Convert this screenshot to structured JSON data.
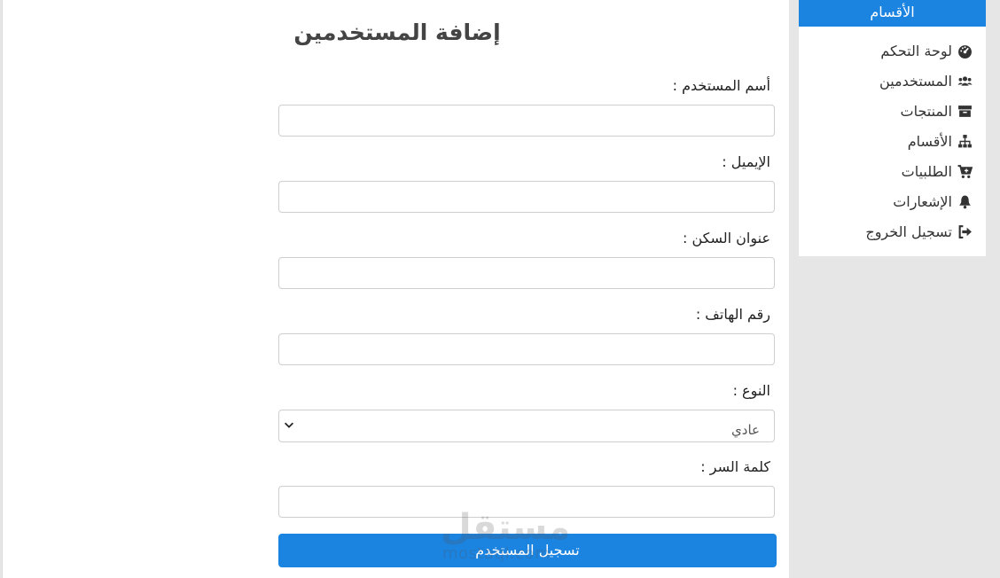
{
  "page": {
    "title": "إضافة المستخدمين"
  },
  "form": {
    "fields": [
      {
        "label": "أسم المستخدم :",
        "value": ""
      },
      {
        "label": "الإيميل :",
        "value": ""
      },
      {
        "label": "عنوان السكن :",
        "value": ""
      },
      {
        "label": "رقم الهاتف :",
        "value": ""
      },
      {
        "label": "النوع :",
        "selected": "عادي"
      },
      {
        "label": "كلمة السر :",
        "value": ""
      }
    ],
    "submit_label": "تسجيل المستخدم"
  },
  "sidebar": {
    "header": "الأقسام",
    "items": [
      {
        "label": "لوحة التحكم",
        "icon": "dashboard-icon"
      },
      {
        "label": "المستخدمين",
        "icon": "users-icon"
      },
      {
        "label": "المنتجات",
        "icon": "archive-icon"
      },
      {
        "label": "الأقسام",
        "icon": "sitemap-icon"
      },
      {
        "label": "الطلبيات",
        "icon": "cart-icon"
      },
      {
        "label": "الإشعارات",
        "icon": "bell-icon"
      },
      {
        "label": "تسجيل الخروج",
        "icon": "sign-out-icon"
      }
    ]
  },
  "watermark": {
    "arabic": "مستقل",
    "latin": "mostaql.com"
  },
  "colors": {
    "accent": "#1b83e0",
    "background": "#e6e6e6"
  }
}
